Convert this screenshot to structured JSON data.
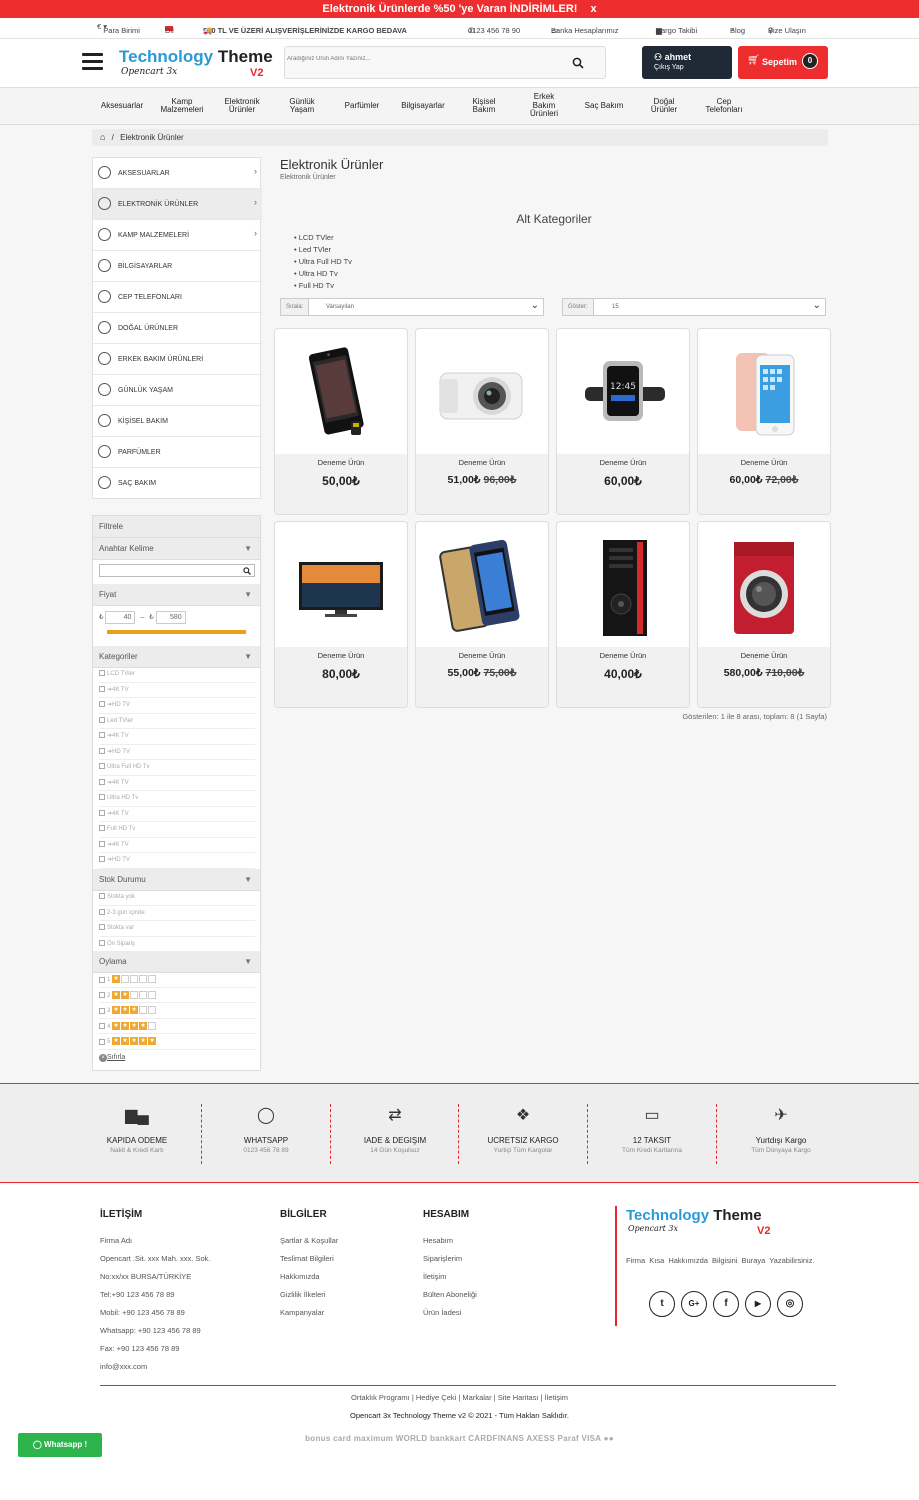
{
  "promo": {
    "text": "Elektronik Ürünlerde %50 'ye Varan İNDİRİMLER!",
    "close": "x"
  },
  "topbar": {
    "currency": "Para Birimi",
    "language": "Dil",
    "shipping_notice": "500 TL VE ÜZERİ ALIŞVERİŞLERİNİZDE KARGO BEDAVA",
    "phone": "0123 456 78 90",
    "bank": "Banka Hesaplarımız",
    "tracking": "Kargo Takibi",
    "blog": "Blog",
    "contact": "Bize Ulaşın"
  },
  "header": {
    "logo_main": "Technology",
    "logo_bold": "Theme",
    "logo_sub": "Opencart 3x",
    "logo_ver": "V2",
    "search_placeholder": "Aradığınız Ürün Adını Yazınız...",
    "user_name": "ahmet",
    "user_action": "Çıkış Yap",
    "cart_label": "Sepetim",
    "cart_count": "0"
  },
  "nav": [
    {
      "label": "Aksesuarlar"
    },
    {
      "label": "Kamp Malzemeleri"
    },
    {
      "label": "Elektronik Ürünler"
    },
    {
      "label": "Günlük Yaşam"
    },
    {
      "label": "Parfümler"
    },
    {
      "label": "Bilgisayarlar"
    },
    {
      "label": "Kişisel Bakım"
    },
    {
      "label": "Erkek Bakım Ürünleri"
    },
    {
      "label": "Saç Bakım"
    },
    {
      "label": "Doğal Ürünler"
    },
    {
      "label": "Cep Telefonları"
    }
  ],
  "breadcrumb": {
    "home_icon": "home-icon",
    "separator": "/",
    "current": "Elektronik Ürünler"
  },
  "sidebar": [
    {
      "label": "AKSESUARLAR",
      "arrow": "›"
    },
    {
      "label": "ELEKTRONİK ÜRÜNLER",
      "arrow": "›"
    },
    {
      "label": "KAMP MALZEMELERİ",
      "arrow": "›"
    },
    {
      "label": "BİLGİSAYARLAR",
      "arrow": ""
    },
    {
      "label": "CEP TELEFONLARI",
      "arrow": ""
    },
    {
      "label": "DOĞAL ÜRÜNLER",
      "arrow": ""
    },
    {
      "label": "ERKEK BAKIM ÜRÜNLERİ",
      "arrow": ""
    },
    {
      "label": "GÜNLÜK YAŞAM",
      "arrow": ""
    },
    {
      "label": "KİŞİSEL BAKIM",
      "arrow": ""
    },
    {
      "label": "PARFÜMLER",
      "arrow": ""
    },
    {
      "label": "SAÇ BAKIM",
      "arrow": ""
    }
  ],
  "filter": {
    "title": "Filtrele",
    "keyword_title": "Anahtar Kelime",
    "price_title": "Fiyat",
    "currency": "₺",
    "dash": "–",
    "price_min": "40",
    "price_max": "580",
    "categories_title": "Kategoriler",
    "categories": [
      "LCD TVler",
      "4K TV",
      "HD TV",
      "Led TVler",
      "4K TV",
      "HD TV",
      "Ultra Full HD Tv",
      "4K TV",
      "Ultra HD Tv",
      "4K TV",
      "Full HD Tv",
      "4K TV",
      "HD TV"
    ],
    "stock_title": "Stok Durumu",
    "stock": [
      "Stokta yok",
      "2-3 gün içinde",
      "Stokta var",
      "Ön Sipariş"
    ],
    "rating_title": "Oylama",
    "ratings": [
      "1",
      "2",
      "3",
      "4",
      "5"
    ],
    "reset": "Sıfırla"
  },
  "main": {
    "title": "Elektronik Ürünler",
    "subtitle": "Elektronik Ürünler",
    "subcat_title": "Alt Kategoriler",
    "subcats": [
      "LCD TVler",
      "Led TVler",
      "Ultra Full HD Tv",
      "Ultra HD Tv",
      "Full HD Tv"
    ],
    "sort_label": "Sırala:",
    "sort_value": "Varsayılan",
    "show_label": "Göster:",
    "show_value": "15",
    "pagination_info": "Gösterilen: 1 ile 8 arası, toplam: 8 (1 Sayfa)"
  },
  "products": [
    {
      "name": "Deneme Ürün",
      "price": "50,00₺",
      "old": "",
      "image": "phone"
    },
    {
      "name": "Deneme Ürün",
      "price": "51,00₺",
      "old": "96,00₺",
      "image": "camera"
    },
    {
      "name": "Deneme Ürün",
      "price": "60,00₺",
      "old": "",
      "image": "watch"
    },
    {
      "name": "Deneme Ürün",
      "price": "60,00₺",
      "old": "72,00₺",
      "image": "iphone"
    },
    {
      "name": "Deneme Ürün",
      "price": "80,00₺",
      "old": "",
      "image": "tv"
    },
    {
      "name": "Deneme Ürün",
      "price": "55,00₺",
      "old": "75,00₺",
      "image": "phone-case"
    },
    {
      "name": "Deneme Ürün",
      "price": "40,00₺",
      "old": "",
      "image": "pc-case"
    },
    {
      "name": "Deneme Ürün",
      "price": "580,00₺",
      "old": "710,00₺",
      "image": "washer"
    }
  ],
  "features": [
    {
      "icon": "truck-icon",
      "title": "KAPIDA ODEME",
      "sub": "Nakit & Kredi Kartı"
    },
    {
      "icon": "whatsapp-icon",
      "title": "WHATSAPP",
      "sub": "0123 456 78 89"
    },
    {
      "icon": "retweet-icon",
      "title": "IADE & DEGIŞIM",
      "sub": "14 Gün Koşulsuz"
    },
    {
      "icon": "dropbox-icon",
      "title": "UCRETSIZ KARGO",
      "sub": "Yurtiçi Tüm Kargolar"
    },
    {
      "icon": "credit-card-icon",
      "title": "12 TAKSIT",
      "sub": "Tüm Kredi Kartlarına"
    },
    {
      "icon": "plane-icon",
      "title": "Yurtdışı Kargo",
      "sub": "Tüm Dünyaya Kargo"
    }
  ],
  "footer": {
    "contact_title": "İLETİŞİM",
    "contact": [
      "Firma Adı",
      "Opencart .Sit. xxx Mah. xxx. Sok.",
      "No:xx/xx BURSA/TÜRKİYE",
      "Tel:+90 123 456 78 89",
      "Mobil: +90 123 456 78 89",
      "Whatsapp: +90 123 456 78 89",
      "Fax: +90 123 456 78 89",
      "info@xxx.com"
    ],
    "info_title": "BİLGİLER",
    "info": [
      "Şartlar & Koşullar",
      "Teslimat Bilgileri",
      "Hakkımızda",
      "Gizlilik İlkeleri",
      "Kampanyalar"
    ],
    "account_title": "HESABIM",
    "account": [
      "Hesabım",
      "Siparişlerim",
      "İletişim",
      "Bülten Aboneliği",
      "Ürün İadesi"
    ],
    "about": "Firma Kısa Hakkımızda Bilgisini Buraya Yazabilirsiniz.",
    "social": [
      "twitter-icon",
      "google-plus-icon",
      "facebook-icon",
      "youtube-icon",
      "instagram-icon"
    ],
    "links": "Ortaklık Programı | Hediye Çeki | Markalar | Site Haritası | İletişim",
    "copyright": "Opencart 3x Technology Theme v2 © 2021 - Tüm Hakları Saklıdır.",
    "payments": "bonus card   maximum   WORLD   bankkart   CARDFINANS   AXESS   Paraf   VISA   ●●"
  },
  "whatsapp_button": "Whatsapp !"
}
